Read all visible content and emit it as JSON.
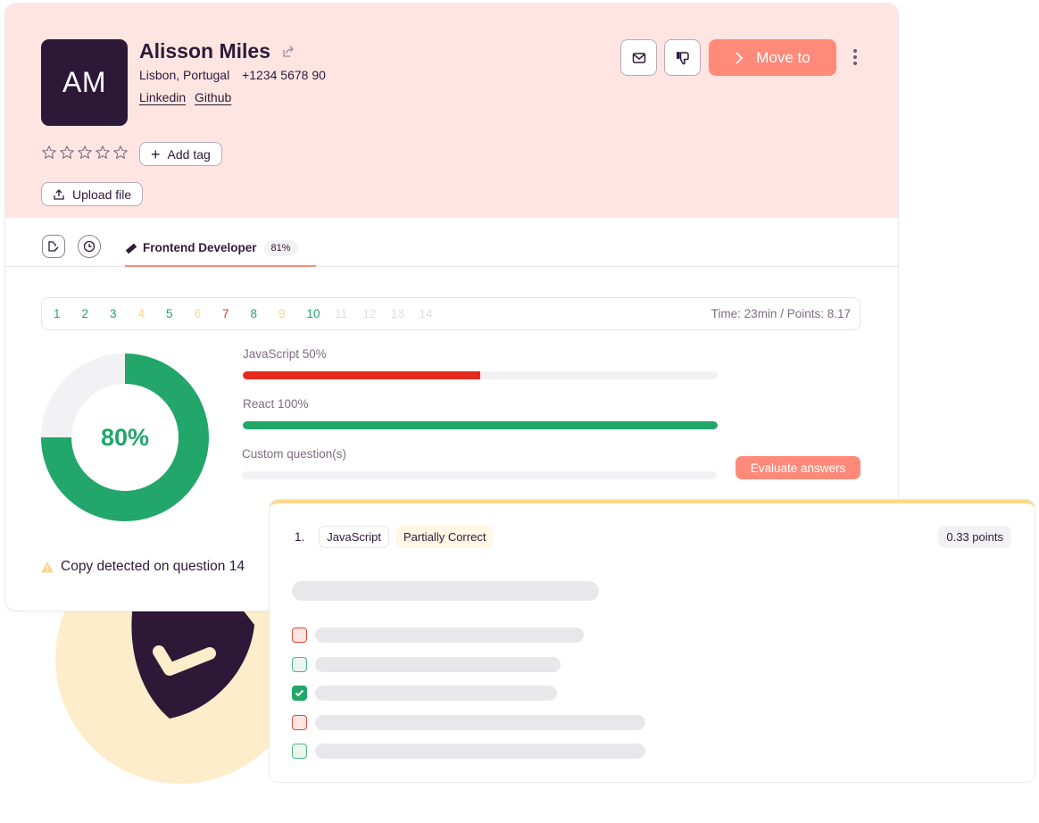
{
  "candidate": {
    "initials": "AM",
    "name": "Alisson Miles",
    "location": "Lisbon, Portugal",
    "phone": "+1234 5678 90",
    "links": [
      "Linkedin",
      "Github"
    ],
    "rating": 0,
    "rating_max": 5,
    "add_tag_label": "Add tag",
    "upload_label": "Upload file"
  },
  "actions": {
    "mail_icon": "mail-icon",
    "dislike_icon": "thumbs-down-icon",
    "move_label": "Move to",
    "more_icon": "kebab-icon"
  },
  "tabs": {
    "icons": [
      "edit-document-icon",
      "clock-icon"
    ],
    "active": {
      "icon": "ruler-icon",
      "label": "Frontend Developer",
      "badge": "81%"
    }
  },
  "questions": {
    "items": [
      {
        "n": "1",
        "status": "correct"
      },
      {
        "n": "2",
        "status": "correct"
      },
      {
        "n": "3",
        "status": "correct"
      },
      {
        "n": "4",
        "status": "partial"
      },
      {
        "n": "5",
        "status": "correct"
      },
      {
        "n": "6",
        "status": "partial"
      },
      {
        "n": "7",
        "status": "wrong"
      },
      {
        "n": "8",
        "status": "correct"
      },
      {
        "n": "9",
        "status": "partial"
      },
      {
        "n": "10",
        "status": "correct"
      },
      {
        "n": "11",
        "status": "pending"
      },
      {
        "n": "12",
        "status": "pending"
      },
      {
        "n": "13",
        "status": "pending"
      },
      {
        "n": "14",
        "status": "pending"
      }
    ],
    "meta": "Time: 23min / Points: 8.17"
  },
  "score": {
    "label": "80%",
    "value": 80
  },
  "skills": [
    {
      "label": "JavaScript 50%",
      "progress": 50,
      "color": "#e52a1e"
    },
    {
      "label": "React 100%",
      "progress": 100,
      "color": "#22a66a"
    },
    {
      "label": "Custom question(s)",
      "progress": 0,
      "color": "#22a66a"
    }
  ],
  "evaluate_label": "Evaluate answers",
  "warning": {
    "icon": "warning-icon",
    "text": "Copy detected on question 14"
  },
  "answer": {
    "number": "1.",
    "topic": "JavaScript",
    "result": "Partially Correct",
    "points": "0.33 points",
    "options": [
      {
        "state": "wrong",
        "checked": false
      },
      {
        "state": "right",
        "checked": false
      },
      {
        "state": "right",
        "checked": true
      },
      {
        "state": "wrong",
        "checked": false
      },
      {
        "state": "right",
        "checked": false
      }
    ]
  },
  "colors": {
    "accent": "#ff8a7a",
    "header_bg": "#ffe5e1",
    "brand_dark": "#2e1837",
    "green": "#22a66a",
    "amber": "#fcd58e",
    "red": "#e32b1f"
  }
}
